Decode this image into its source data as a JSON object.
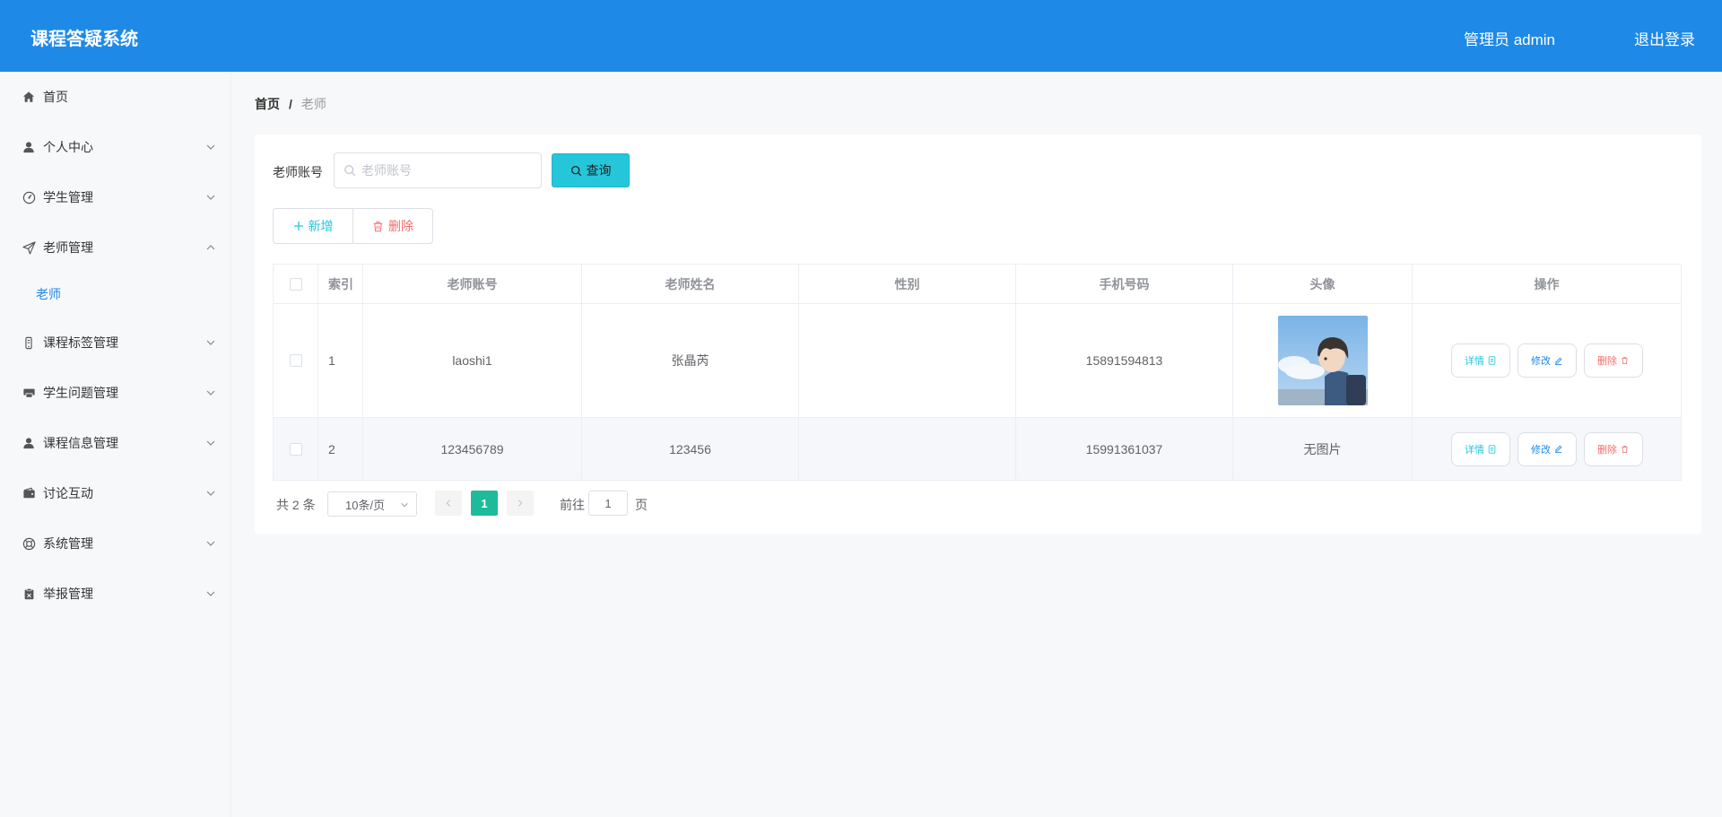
{
  "header": {
    "title": "课程答疑系统",
    "user": "管理员 admin",
    "logout": "退出登录"
  },
  "sidebar": {
    "items": [
      {
        "label": "首页",
        "icon": "home-icon"
      },
      {
        "label": "个人中心",
        "icon": "user-icon"
      },
      {
        "label": "学生管理",
        "icon": "gauge-icon"
      },
      {
        "label": "老师管理",
        "icon": "send-icon"
      },
      {
        "label": "课程标签管理",
        "icon": "phone-icon"
      },
      {
        "label": "学生问题管理",
        "icon": "printer-icon"
      },
      {
        "label": "课程信息管理",
        "icon": "user-icon"
      },
      {
        "label": "讨论互动",
        "icon": "wallet-icon"
      },
      {
        "label": "系统管理",
        "icon": "help-icon"
      },
      {
        "label": "举报管理",
        "icon": "clipboard-icon"
      }
    ],
    "subitem": "老师"
  },
  "breadcrumb": {
    "home": "首页",
    "separator": "/",
    "current": "老师"
  },
  "search": {
    "label": "老师账号",
    "placeholder": "老师账号",
    "button": "查询"
  },
  "actions": {
    "add": "新增",
    "delete": "删除"
  },
  "table": {
    "columns": [
      "索引",
      "老师账号",
      "老师姓名",
      "性别",
      "手机号码",
      "头像",
      "操作"
    ],
    "rows": [
      {
        "index": "1",
        "account": "laoshi1",
        "name": "张晶芮",
        "gender": "",
        "phone": "15891594813",
        "avatar": ""
      },
      {
        "index": "2",
        "account": "123456789",
        "name": "123456",
        "gender": "",
        "phone": "15991361037",
        "avatar": "无图片"
      }
    ],
    "ops": {
      "detail": "详情",
      "edit": "修改",
      "delete": "删除"
    }
  },
  "pagination": {
    "total": "共 2 条",
    "page_size": "10条/页",
    "current_page": "1",
    "goto_label": "前往",
    "goto_value": "1",
    "page_suffix": "页"
  },
  "colors": {
    "header": "#1e89e6",
    "accent": "#26c6da",
    "danger": "#f56c6c",
    "active_page": "#1dbb9b"
  }
}
